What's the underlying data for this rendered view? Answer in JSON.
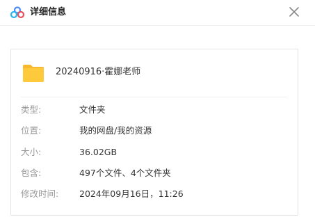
{
  "dialog": {
    "title": "详细信息",
    "logo_icon": "cloud-logo-icon",
    "close_icon": "close-icon"
  },
  "folder": {
    "icon": "folder-icon",
    "icon_color": "#FFC93C",
    "name": "20240916·霍娜老师"
  },
  "details": [
    {
      "label": "类型:",
      "value": "文件夹"
    },
    {
      "label": "位置:",
      "value": "我的网盘/我的资源"
    },
    {
      "label": "大小:",
      "value": "36.02GB"
    },
    {
      "label": "包含:",
      "value": "497个文件、4个文件夹"
    },
    {
      "label": "修改时间:",
      "value": "2024年09月16日，11:26"
    }
  ]
}
